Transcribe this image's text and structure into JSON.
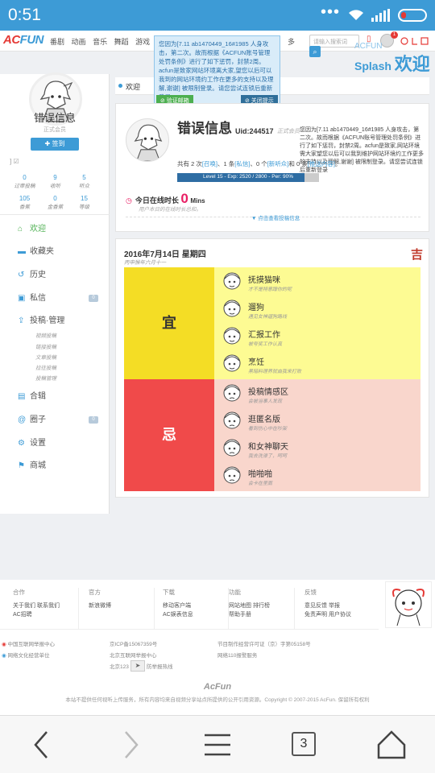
{
  "status_bar": {
    "time": "0:51",
    "dots": "•••"
  },
  "nav": {
    "logo_a": "AC",
    "logo_b": "FUN",
    "links": [
      "番剧",
      "动画",
      "音乐",
      "舞蹈",
      "游戏",
      "娱乐"
    ],
    "more": "多",
    "search_placeholder": "请输入搜索词",
    "notif_count": "1"
  },
  "splash": {
    "small": "ACFUN",
    "big": "Splash",
    "welcome": "欢迎"
  },
  "popup": {
    "text": "您因为[7.11 ab1470449_16#1985 人身攻击，第二次。故而根据《ACFUN账号管理处罚条例》进行了如下惩罚，封禁2周。acfun是致家网站环境离大家,望您以后可以我到的网站环境约工作在更多的支持以及理解,谢谢] 被限制登录。请您尝试连锁后重新登录",
    "verify_btn": "⊘ 验证邮箱",
    "close_btn": "⊘ 关闭提示"
  },
  "sidebar": {
    "name": "错误信息",
    "role": "正式会员",
    "sign_btn": "✚ 签到",
    "edit": "] ☑",
    "stats": [
      {
        "n": "0",
        "l": "过审投稿"
      },
      {
        "n": "9",
        "l": "收听"
      },
      {
        "n": "5",
        "l": "听众"
      },
      {
        "n": "105",
        "l": "香蕉"
      },
      {
        "n": "0",
        "l": "金香蕉"
      },
      {
        "n": "15",
        "l": "等级"
      }
    ],
    "menu": [
      {
        "label": "欢迎",
        "icon": "⌂"
      },
      {
        "label": "收藏夹",
        "icon": "▬"
      },
      {
        "label": "历史",
        "icon": "↺"
      },
      {
        "label": "私信",
        "icon": "▣",
        "badge": "0"
      },
      {
        "label": "投稿·管理",
        "icon": "⇪"
      },
      {
        "label": "合辑",
        "icon": "▤"
      },
      {
        "label": "圈子",
        "icon": "@",
        "badge": "0"
      },
      {
        "label": "设置",
        "icon": "⚙"
      },
      {
        "label": "商城",
        "icon": "⚑"
      }
    ],
    "submenu": [
      "视频投稿",
      "链接投稿",
      "文章投稿",
      "拉往投稿",
      "投稿管理"
    ]
  },
  "content_tab": "欢迎",
  "profile": {
    "name": "错误信息",
    "uid": "Uid:244517",
    "role": "正式会员",
    "notice": "您因为[7.11 ab1470449_16#1985 人身攻击，第二次。故而根据《ACFUN账号管理处罚条例》进行了如下惩罚，封禁2周。acfun是致家,网站环境需大家望您以后可以我到维护网站环境约工作更多的支持以及理解,谢谢] 被限制登录。请您尝试连锁后重新登录",
    "counts": {
      "p1": "共有 2 次",
      "l1": "[召唤]",
      "p2": "、1 条",
      "l2": "[私信]",
      "p3": "、0 个",
      "l3": "[新听众]",
      "p4": "和 0 条",
      "l4": "[推送内容]",
      "p5": "。"
    },
    "level_text": "Level 15 - Exp: 2520 / 2800 - Per: 90%",
    "level_fraction": 0.9,
    "online_label": "今日在线时长",
    "online_value": "0",
    "online_unit": "Mins",
    "online_sub": "用户本日的在线时长总和。",
    "more_link": "▼ 点击查看投稿信息"
  },
  "fortune": {
    "date": "2016年7月14日 星期四",
    "lunar": "丙申猴年六月十一",
    "luck": "吉",
    "yi_label": "宜",
    "ji_label": "忌",
    "yi": [
      {
        "title": "抚摸猫咪",
        "sub": "才不是特意蹭你的呢"
      },
      {
        "title": "遛狗",
        "sub": "遇见女神遛狗路线"
      },
      {
        "title": "汇报工作",
        "sub": "被夸奖工作认真"
      },
      {
        "title": "烹饪",
        "sub": "黑暗料理界就由我来打败"
      }
    ],
    "ji": [
      {
        "title": "投稿情感区",
        "sub": "会被当事人发现"
      },
      {
        "title": "逛匿名版",
        "sub": "看到伤心中在吵架"
      },
      {
        "title": "和女神聊天",
        "sub": "我去洗澡了，呵呵"
      },
      {
        "title": "啪啪啪",
        "sub": "会卡在里面"
      }
    ]
  },
  "footer": {
    "cols": [
      {
        "h": "合作",
        "links": [
          "关于我们  联系我们",
          "AC招聘"
        ]
      },
      {
        "h": "官方",
        "links": [
          "新浪微博"
        ]
      },
      {
        "h": "下载",
        "links": [
          "移动客户端",
          "AC娱表信息"
        ]
      },
      {
        "h": "功能",
        "links": [
          "网站地图  排行榜",
          "帮助手册"
        ]
      },
      {
        "h": "反馈",
        "links": [
          "意见反馈  举报",
          "免责声明  用户协议"
        ]
      }
    ],
    "row1": [
      "中国互联网举报中心",
      "京ICP备15067359号",
      "节目制作经营许可证（京）字第05158号"
    ],
    "row2": [
      "网络文化经营单位",
      "北京互联网举报中心",
      "网络110报警服务"
    ],
    "row3": [
      "北京123",
      "防举报热线"
    ],
    "brand": "AcFun",
    "copyright": "本站不提供任何视听上传服务，所有内容均来自视频分享站点所提供的公开引用资源。Copyright © 2007-2015 AcFun. 保留所有权利"
  },
  "browser": {
    "tabs_count": "3"
  }
}
